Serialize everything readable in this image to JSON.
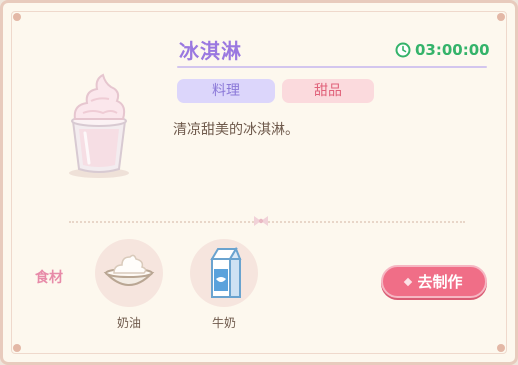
{
  "recipe": {
    "title": "冰淇淋",
    "time": "03:00:00",
    "tags": [
      "料理",
      "甜品"
    ],
    "description": "清凉甜美的冰淇淋。"
  },
  "ingredients": {
    "label": "食材",
    "items": [
      {
        "name": "奶油",
        "icon": "cream-bowl-icon"
      },
      {
        "name": "牛奶",
        "icon": "milk-carton-icon"
      }
    ]
  },
  "actions": {
    "make_label": "去制作"
  },
  "colors": {
    "title": "#9a78e0",
    "timer": "#34b36a",
    "button": "#f06e87",
    "tag_cooking_bg": "#dcd6fb",
    "tag_dessert_bg": "#fbdadd"
  }
}
